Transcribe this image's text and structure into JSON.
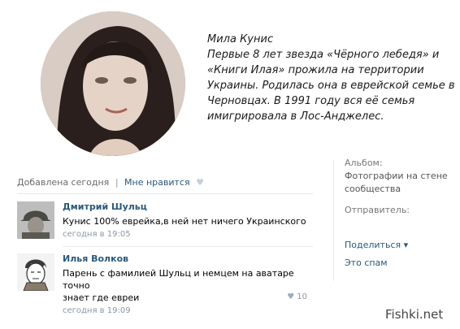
{
  "caption": {
    "lines": [
      "Мила Кунис",
      "Первые 8 лет звезда «Чёрного лебедя» и",
      "«Книги Илая» прожила на территории",
      "Украины. Родилась она в еврейской семье в",
      "Черновцах. В 1991 году вся её семья",
      "имигрировала в Лос-Анджелес."
    ]
  },
  "post_meta": {
    "added": "Добавлена сегодня",
    "separator": "|",
    "like_label": "Мне нравится"
  },
  "comments": [
    {
      "author": "Дмитрий Шульц",
      "text": "Кунис 100% еврейка,в ней нет ничего Украинского",
      "date": "сегодня в 19:05",
      "likes": ""
    },
    {
      "author": "Илья Волков",
      "text_lines": [
        "Парень с фамилией Шульц и немцем на аватаре точно",
        "знает где евреи"
      ],
      "date": "сегодня в 19:09",
      "likes": "10"
    }
  ],
  "sidebar": {
    "album_label": "Альбом:",
    "album_value_lines": [
      "Фотографии на стене",
      "сообщества"
    ],
    "sender_label": "Отправитель:",
    "share": "Поделиться ▾",
    "spam": "Это спам"
  },
  "watermark": "Fishki.net",
  "colors": {
    "link": "#2b587a",
    "muted": "#8a97a5",
    "divider": "#e6eaee"
  }
}
